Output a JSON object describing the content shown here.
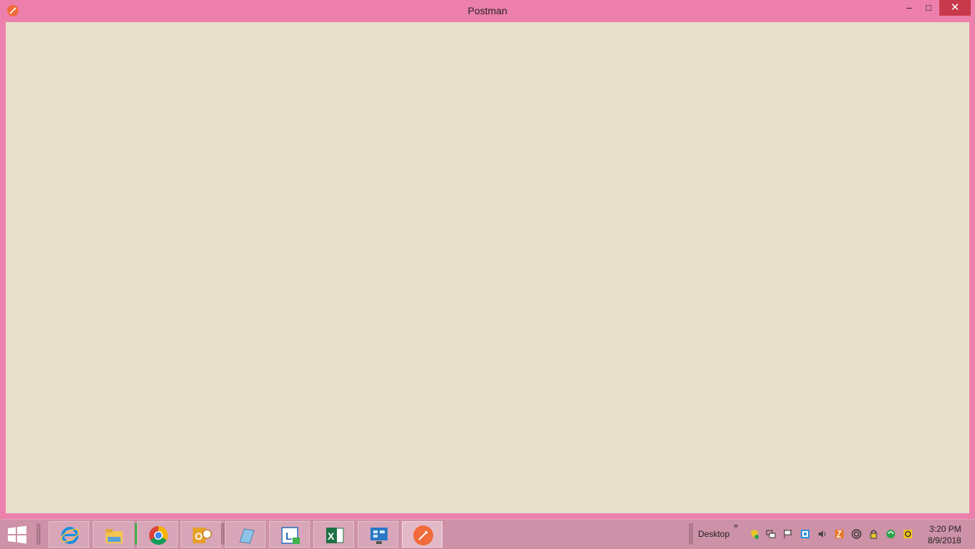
{
  "window": {
    "title": "Postman",
    "app_icon": "postman-icon",
    "controls": {
      "minimize": "–",
      "maximize": "□",
      "close": "✕"
    }
  },
  "taskbar": {
    "start_icon": "windows-start-icon",
    "pinned": [
      {
        "name": "internet-explorer-icon"
      },
      {
        "name": "file-explorer-icon"
      },
      {
        "name": "chrome-icon"
      },
      {
        "name": "outlook-icon"
      },
      {
        "name": "notepad-icon"
      },
      {
        "name": "lync-icon"
      },
      {
        "name": "excel-icon"
      },
      {
        "name": "remote-desktop-icon"
      },
      {
        "name": "postman-icon",
        "active": true
      }
    ],
    "toolbar_label": "Desktop",
    "toolbar_chevron": "»",
    "tray_icons": [
      "shield-icon",
      "network-icon",
      "flag-icon",
      "dropbox-icon",
      "speaker-icon",
      "java-icon",
      "sync-icon",
      "lock-icon",
      "update-icon",
      "norton-icon"
    ],
    "clock": {
      "time": "3:20 PM",
      "date": "8/9/2018"
    }
  }
}
